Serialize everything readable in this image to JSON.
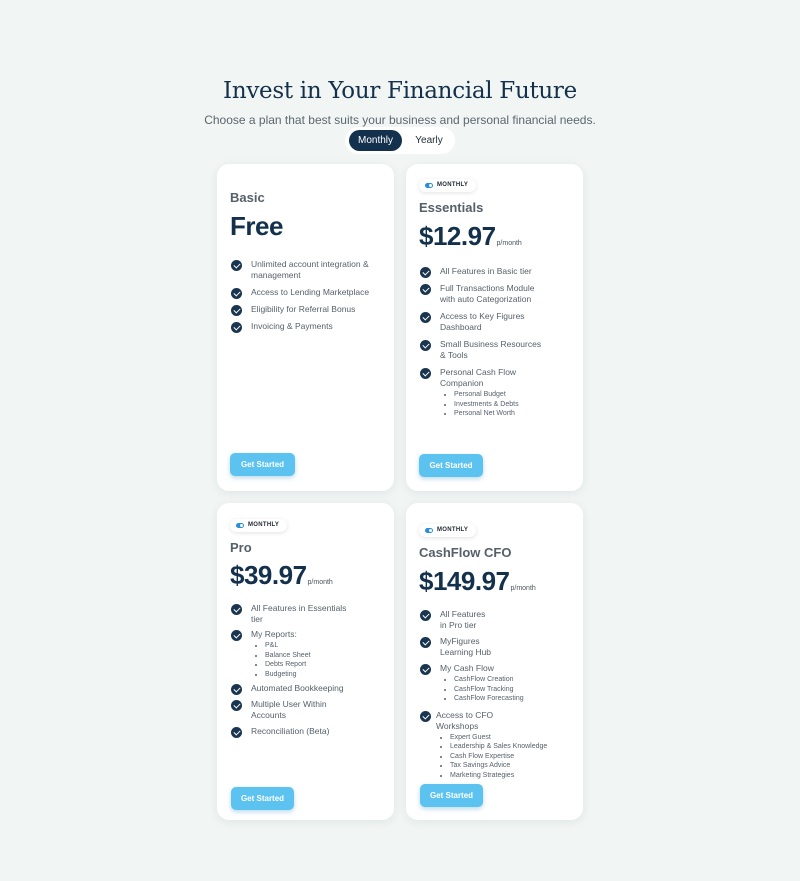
{
  "header": {
    "title": "Invest in Your Financial Future",
    "subtitle": "Choose a plan that best suits your business and personal financial needs."
  },
  "billing_toggle": {
    "options": [
      "Monthly",
      "Yearly"
    ],
    "selected": "Monthly"
  },
  "colors": {
    "background": "#f1f6f4",
    "navy": "#13314c",
    "button": "#5cc2ef",
    "badge_toggle": "#2a8fd8"
  },
  "icons": [
    "check-circle-icon",
    "toggle-icon"
  ],
  "plans": [
    {
      "name": "Basic",
      "price": "Free",
      "per": "",
      "badge": "",
      "cta": "Get Started",
      "features": [
        {
          "text": "Unlimited account integration & management",
          "sub": []
        },
        {
          "text": "Access to Lending Marketplace",
          "sub": []
        },
        {
          "text": "Eligibility for Referral Bonus",
          "sub": []
        },
        {
          "text": "Invoicing & Payments",
          "sub": []
        }
      ]
    },
    {
      "name": "Essentials",
      "price": "$12.97",
      "per": "p/month",
      "badge": "MONTHLY",
      "cta": "Get Started",
      "features": [
        {
          "text": "All Features in Basic tier",
          "sub": []
        },
        {
          "text": "Full Transactions Module with auto Categorization",
          "sub": []
        },
        {
          "text": "Access to Key Figures Dashboard",
          "sub": []
        },
        {
          "text": "Small Business Resources & Tools",
          "sub": []
        },
        {
          "text": "Personal Cash Flow Companion",
          "sub": [
            "Personal Budget",
            "Investments & Debts",
            "Personal Net Worth"
          ]
        }
      ]
    },
    {
      "name": "Pro",
      "price": "$39.97",
      "per": "p/month",
      "badge": "MONTHLY",
      "cta": "Get Started",
      "features": [
        {
          "text": "All Features in Essentials tier",
          "sub": []
        },
        {
          "text": "My Reports:",
          "sub": [
            "P&L",
            "Balance Sheet",
            "Debts Report",
            "Budgeting"
          ]
        },
        {
          "text": "Automated Bookkeeping",
          "sub": []
        },
        {
          "text": "Multiple User Within Accounts",
          "sub": []
        },
        {
          "text": "Reconciliation (Beta)",
          "sub": []
        }
      ]
    },
    {
      "name": "CashFlow CFO",
      "price": "$149.97",
      "per": "p/month",
      "badge": "MONTHLY",
      "cta": "Get Started",
      "features": [
        {
          "text": "All Features in Pro tier",
          "sub": []
        },
        {
          "text": "MyFigures Learning Hub",
          "sub": []
        },
        {
          "text": "My Cash Flow",
          "sub": [
            "CashFlow Creation",
            "CashFlow Tracking",
            "CashFlow Forecasting"
          ]
        },
        {
          "text": "Access to CFO Workshops",
          "sub": [
            "Expert Guest",
            "Leadership & Sales Knowledge",
            "Cash Flow Expertise",
            "Tax Savings Advice",
            "Marketing Strategies"
          ]
        }
      ]
    }
  ]
}
